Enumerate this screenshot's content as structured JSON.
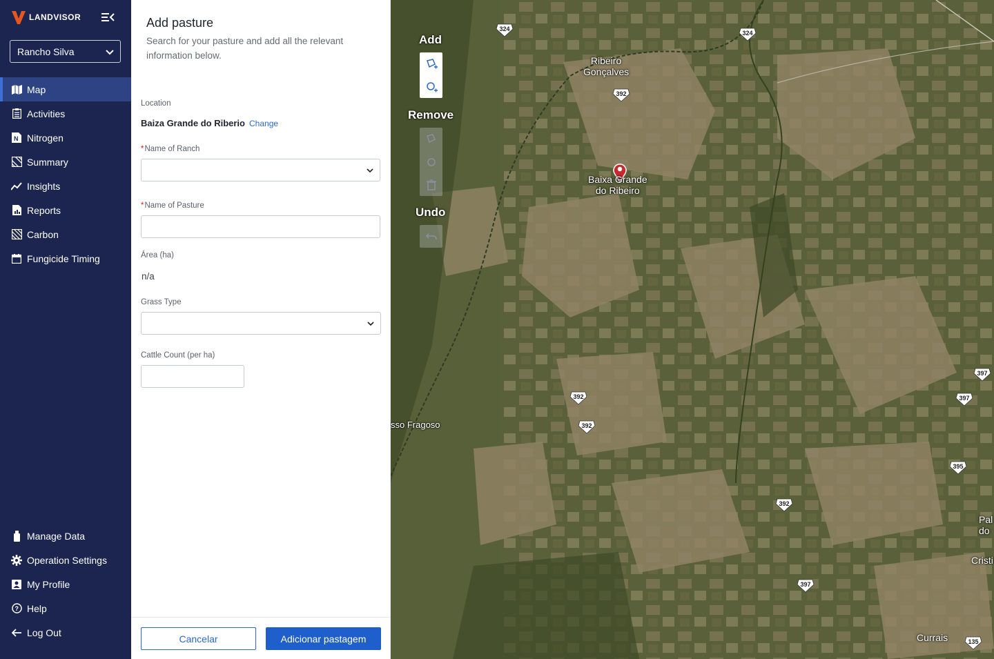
{
  "brand": {
    "name": "LANDVISOR"
  },
  "sidebar": {
    "ranch_selected": "Rancho Silva",
    "items": [
      {
        "label": "Map",
        "icon": "map-icon",
        "active": true
      },
      {
        "label": "Activities",
        "icon": "clipboard-icon"
      },
      {
        "label": "Nitrogen",
        "icon": "nitrogen-icon"
      },
      {
        "label": "Summary",
        "icon": "summary-icon"
      },
      {
        "label": "Insights",
        "icon": "trend-icon"
      },
      {
        "label": "Reports",
        "icon": "report-icon"
      },
      {
        "label": "Carbon",
        "icon": "carbon-icon"
      },
      {
        "label": "Fungicide Timing",
        "icon": "calendar-icon"
      }
    ],
    "bottom_items": [
      {
        "label": "Manage Data",
        "icon": "usb-icon"
      },
      {
        "label": "Operation Settings",
        "icon": "gear-icon"
      },
      {
        "label": "My Profile",
        "icon": "profile-icon"
      },
      {
        "label": "Help",
        "icon": "help-icon"
      },
      {
        "label": "Log Out",
        "icon": "logout-icon"
      }
    ]
  },
  "form": {
    "title": "Add pasture",
    "subtitle": "Search for your pasture and add all the relevant information below.",
    "location_label": "Location",
    "location_value": "Baiza Grande do Riberio",
    "change_link": "Change",
    "ranch_name_label": "Name of Ranch",
    "pasture_name_label": "Name of Pasture",
    "area_label": "Área (ha)",
    "area_value": "n/a",
    "grass_type_label": "Grass Type",
    "cattle_label": "Cattle Count (per ha)",
    "required_mark": "*",
    "cancel_label": "Cancelar",
    "submit_label": "Adicionar pastagem"
  },
  "map": {
    "tools": {
      "add_label": "Add",
      "remove_label": "Remove",
      "undo_label": "Undo"
    },
    "places": {
      "ribeiro": "Ribeiro\nGonçalves",
      "baixa": "Baixa Grande\ndo Ribeiro",
      "fragoso": "sso Fragoso",
      "currais": "Currais",
      "cristi": "Cristi",
      "pal": "Pal\ndo"
    },
    "shields": {
      "s324a": "324",
      "s324b": "324",
      "s392a": "392",
      "s392b": "392",
      "s392c": "392",
      "s392d": "392",
      "s397a": "397",
      "s397b": "397",
      "s397c": "397",
      "s395": "395",
      "s135": "135"
    },
    "colors": {
      "vegetation": "#4d5430",
      "cleared": "#9a8b64",
      "marker": "#c62a2f"
    }
  }
}
